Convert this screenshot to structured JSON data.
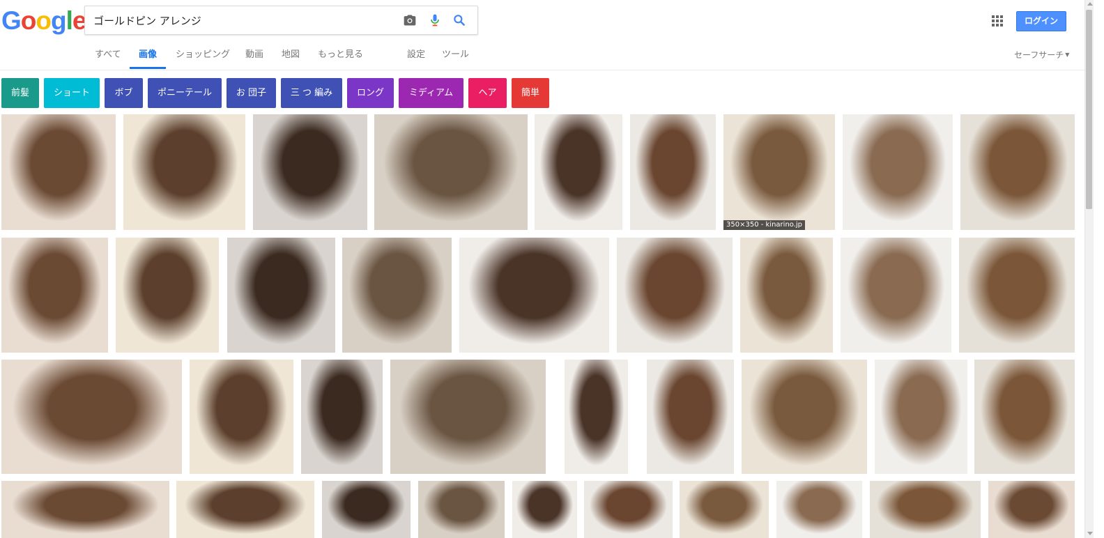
{
  "logo": "Google",
  "search": {
    "query": "ゴールドピン アレンジ"
  },
  "header": {
    "login_label": "ログイン"
  },
  "tabs": [
    {
      "label": "すべて",
      "active": false
    },
    {
      "label": "画像",
      "active": true
    },
    {
      "label": "ショッピング",
      "active": false
    },
    {
      "label": "動画",
      "active": false
    },
    {
      "label": "地図",
      "active": false
    },
    {
      "label": "もっと見る",
      "active": false
    },
    {
      "label": "設定",
      "active": false
    },
    {
      "label": "ツール",
      "active": false
    }
  ],
  "safe_search_label": "セーフサーチ",
  "chips": [
    {
      "label": "前髪",
      "color": "#1a9a8b"
    },
    {
      "label": "ショート",
      "color": "#00bcd4"
    },
    {
      "label": "ボブ",
      "color": "#3f51b5"
    },
    {
      "label": "ポニーテール",
      "color": "#3f51b5"
    },
    {
      "label": "お 団子",
      "color": "#3f51b5"
    },
    {
      "label": "三 つ 編み",
      "color": "#3f51b5"
    },
    {
      "label": "ロング",
      "color": "#7b36c7"
    },
    {
      "label": "ミディアム",
      "color": "#9c27b0"
    },
    {
      "label": "ヘア",
      "color": "#e91e63"
    },
    {
      "label": "簡単",
      "color": "#e53935"
    }
  ],
  "result_caption": "350×350 - kinarino.jp",
  "colors": {
    "accent": "#1a73e8",
    "login_button": "#4d90fe"
  },
  "icons": [
    "camera-icon",
    "mic-icon",
    "search-icon",
    "apps-grid-icon",
    "dropdown-arrow-icon"
  ]
}
